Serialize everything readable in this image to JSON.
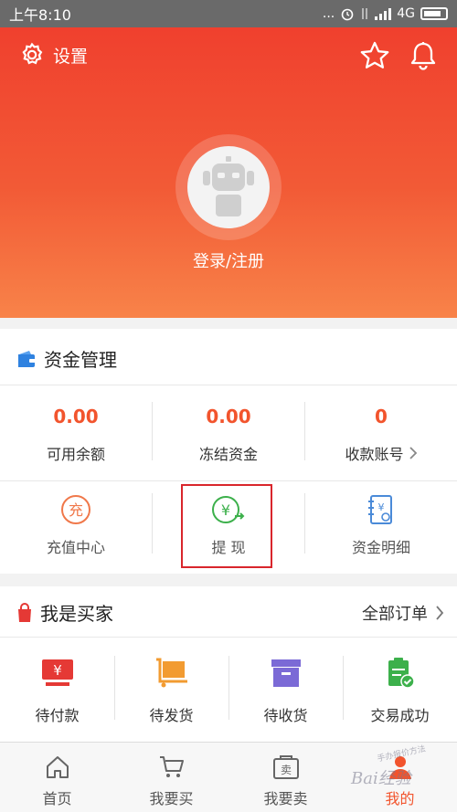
{
  "status_bar": {
    "time": "上午8:10",
    "dots": "...",
    "network": "4G"
  },
  "header": {
    "settings_label": "设置",
    "login_label": "登录/注册"
  },
  "funds": {
    "title": "资金管理",
    "stats": [
      {
        "value": "0.00",
        "label": "可用余额"
      },
      {
        "value": "0.00",
        "label": "冻结资金"
      },
      {
        "value": "0",
        "label": "收款账号"
      }
    ],
    "tools": [
      {
        "label": "充值中心",
        "icon": "recharge-icon",
        "glyph": "充"
      },
      {
        "label": "提  现",
        "icon": "withdraw-icon",
        "glyph": "¥"
      },
      {
        "label": "资金明细",
        "icon": "details-notebook-icon",
        "glyph": "¥"
      }
    ]
  },
  "buyer": {
    "title": "我是买家",
    "all_orders": "全部订单",
    "orders": [
      {
        "label": "待付款",
        "icon": "pending-payment-icon",
        "glyph": "¥"
      },
      {
        "label": "待发货",
        "icon": "pending-shipment-icon"
      },
      {
        "label": "待收货",
        "icon": "pending-receipt-icon"
      },
      {
        "label": "交易成功",
        "icon": "trade-success-icon"
      }
    ]
  },
  "tabbar": {
    "tabs": [
      {
        "label": "首页",
        "icon": "home-icon"
      },
      {
        "label": "我要买",
        "icon": "cart-icon"
      },
      {
        "label": "我要卖",
        "icon": "sell-icon",
        "glyph": "卖"
      },
      {
        "label": "我的",
        "icon": "profile-icon"
      }
    ],
    "active": "我的"
  },
  "watermark": {
    "text": "Bai经验",
    "sub": "手办报价方法"
  },
  "colors": {
    "accent": "#f2542d",
    "header_top": "#f0402e",
    "header_bottom": "#f88349",
    "highlight_box": "#d9262c"
  }
}
